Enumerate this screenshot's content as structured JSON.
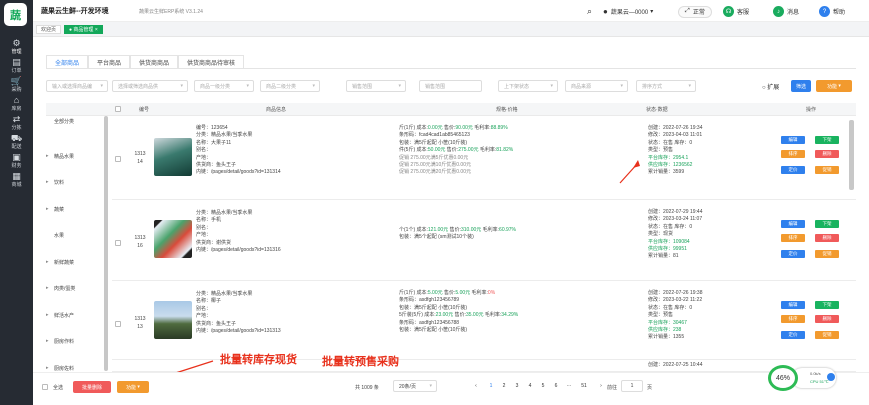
{
  "app": {
    "logo": "蔬",
    "title": "蔬果云生鲜--开发环境",
    "subtitle": "蔬果云生鲜ERP系统  V3.1.24"
  },
  "rail": [
    {
      "icon": "⚙",
      "label": "管理"
    },
    {
      "icon": "▤",
      "label": "订单"
    },
    {
      "icon": "🛒",
      "label": "采购"
    },
    {
      "icon": "⌂",
      "label": "库房"
    },
    {
      "icon": "⇄",
      "label": "分拣"
    },
    {
      "icon": "⛟",
      "label": "配送"
    },
    {
      "icon": "▣",
      "label": "财务"
    },
    {
      "icon": "▦",
      "label": "商城"
    }
  ],
  "header": {
    "search_icon": "search-icon",
    "user": "蔬果云—0000",
    "user_caret": "▾",
    "fullscreen": "正常",
    "service": "客服",
    "message": "消息",
    "help": "帮助"
  },
  "tags": {
    "home": "欢迎页",
    "current": "商品管理",
    "close": "×"
  },
  "tabs": [
    {
      "label": "全部商品",
      "active": true
    },
    {
      "label": "平台商品",
      "active": false
    },
    {
      "label": "供货商商品",
      "active": false
    },
    {
      "label": "供货商商品待审核",
      "active": false
    }
  ],
  "filters": {
    "keyword": "输入或选择商品编",
    "supplier": "选择或筛选商品供",
    "cat1": "商品一级分类",
    "cat2": "商品二级分类",
    "cat3": "销售范围",
    "tag": "销售范围",
    "shelf": "上下架状态",
    "source": "商品来源",
    "sort": "排序方式",
    "expand": "扩展",
    "search": "筛选",
    "function": "功能"
  },
  "table_header": {
    "id": "编号",
    "info": "商品信息",
    "spec": "规格·价格",
    "status": "状态·数据",
    "ops": "操作"
  },
  "categories": [
    {
      "name": "全部分类",
      "arrow": ""
    },
    {
      "name": "精品水果",
      "arrow": "▸"
    },
    {
      "name": "饮料",
      "arrow": "▸"
    },
    {
      "name": "蔬菜",
      "arrow": "▸"
    },
    {
      "name": "水果",
      "arrow": ""
    },
    {
      "name": "新鲜蔬菜",
      "arrow": "▸"
    },
    {
      "name": "肉类/蛋类",
      "arrow": "▸"
    },
    {
      "name": "鲜活水产",
      "arrow": "▸"
    },
    {
      "name": "厨房作料",
      "arrow": "▸"
    },
    {
      "name": "厨房佐料",
      "arrow": "▸"
    }
  ],
  "rows": [
    {
      "id_l1": "1313",
      "id_l2": "14",
      "info": [
        "编号：123654",
        "分类：精品水果/当季水果",
        "名称：大果子11",
        "别名：",
        "产地：",
        "供货商：鱼头王子",
        "内链：/pages/detail/goods?id=131314"
      ],
      "spec": [
        {
          "t": "斤(1斤)  成本:",
          "v1": "0.00元",
          "t2": " 售价:",
          "v2": "90.00元",
          "t3": "  毛利率:",
          "v3": "88.89%"
        },
        {
          "t": "条形码：fcad4cad1ab85465123"
        },
        {
          "t": "包装：满5斤起配 小筐(10斤装)"
        },
        {
          "t": "件(5斤)  成本:",
          "v1": "50.00元",
          "t2": " 售价:",
          "v2": "275.00元",
          "t3": "  毛利率:",
          "v3": "81.82%"
        },
        {
          "t": "   促销     275.00元满5斤优惠0.00元",
          "gray": true
        },
        {
          "t": "   促销     275.00元满10斤优惠0.00元",
          "gray": true
        },
        {
          "t": "   促销     275.00元满20斤优惠0.00元",
          "gray": true
        }
      ],
      "status": [
        "创建：2022-07-26 19:34",
        "修改：2023-04-03 11:01",
        "状态：在售    库存：0",
        "类型：预售",
        "平台库存：2954.1",
        "供应库存：1236562",
        "累计销量：3599"
      ],
      "has_enable": true
    },
    {
      "id_l1": "1313",
      "id_l2": "16",
      "info": [
        "分类：精品水果/当季水果",
        "名称：手机",
        "别名：",
        "产地：",
        "供货商：谢供货",
        "内链：/pages/detail/goods?id=131316"
      ],
      "spec": [
        {
          "t": "个(1个)  成本:",
          "v1": "121.00元",
          "t2": " 售价:",
          "v2": "310.00元",
          "t3": "  毛利率:",
          "v3": "60.97%"
        },
        {
          "t": "包装：满5个起配 (sm测试10个装)"
        }
      ],
      "status": [
        "创建：2022-07-29 19:44",
        "修改：2023-03-24 11:07",
        "状态：在售    库存：0",
        "类型：现货",
        "平台库存：109084",
        "供应库存：99951",
        "累计销量：81"
      ],
      "has_enable": false
    },
    {
      "id_l1": "1313",
      "id_l2": "13",
      "info": [
        "分类：精品水果/当季水果",
        "名称：椰子",
        "别名：",
        "产地：",
        "供货商：鱼头王子",
        "内链：/pages/detail/goods?id=131313"
      ],
      "spec": [
        {
          "t": "斤(1斤)  成本:",
          "v1": "5.00元",
          "t2": " 售价:",
          "v2": "5.00元",
          "t3": "  毛利率:",
          "v3": "0%",
          "red": true
        },
        {
          "t": "条形码：asdfgh123456789"
        },
        {
          "t": "包装：满5斤起配 小筐(10斤装)"
        },
        {
          "t": "5斤装(5斤)  成本:",
          "v1": "23.00元",
          "t2": " 售价:",
          "v2": "35.00元",
          "t3": "  毛利率:",
          "v3": "34.29%"
        },
        {
          "t": "条形码：asdfgh123456788"
        },
        {
          "t": "包装：满5斤起配 小筐(10斤装)"
        }
      ],
      "status": [
        "创建：2022-07-26 19:38",
        "修改：2023-03-22 11:22",
        "状态：在售    库存：0",
        "类型：预售",
        "平台库存：30467",
        "供应库存：238",
        "累计销量：1355"
      ],
      "has_enable": false
    },
    {
      "id_l1": "",
      "id_l2": "",
      "info": [],
      "spec": [],
      "status": [
        "创建：2022-07-25 10:44"
      ],
      "has_enable": false
    }
  ],
  "ops": {
    "edit": "编辑",
    "offshelf": "下架",
    "sort": "排序",
    "delete": "删除",
    "price": "定价",
    "promo": "促销"
  },
  "footer": {
    "select_all": "全选",
    "batch_delete": "批量删除",
    "function": "功能",
    "total": "共 1009 条",
    "page_size": "20条/页",
    "pages": [
      "‹",
      "1",
      "2",
      "3",
      "4",
      "5",
      "6",
      "···",
      "51",
      "›"
    ],
    "goto_label": "前往",
    "goto_value": "1",
    "page_unit": "页"
  },
  "annotations": {
    "a1": "批量转库存现货",
    "a2": "批量转预售采购"
  },
  "monitor": {
    "percent": "46%",
    "net": "0.0k/s",
    "cpu": "CPU 51℃"
  },
  "colors": {
    "brand": "#13a85a",
    "blue": "#2f80ed",
    "green": "#19b35f",
    "orange": "#f29a2e",
    "red": "#f05a5a",
    "annotation": "#e8311c"
  }
}
